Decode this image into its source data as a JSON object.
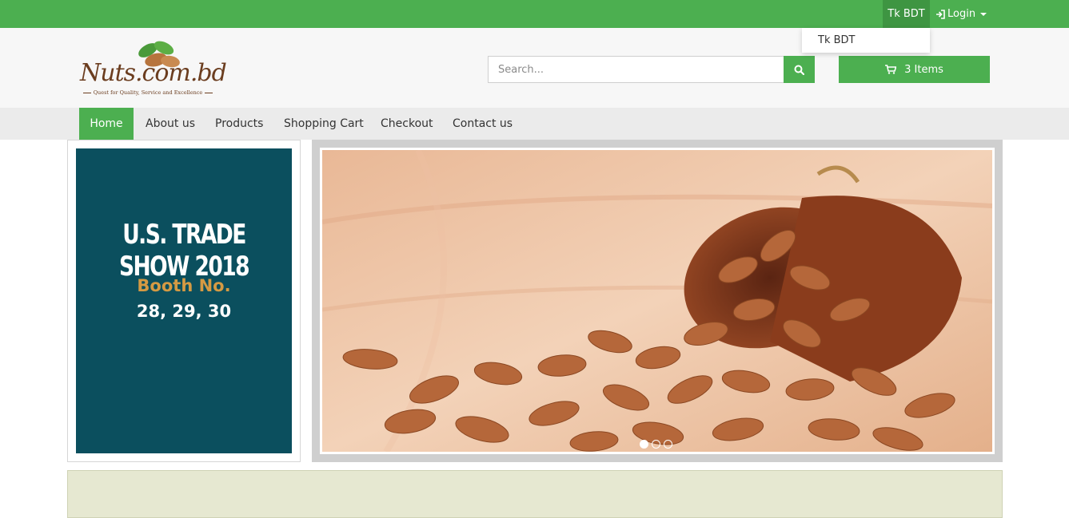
{
  "topbar": {
    "currency": "Tk BDT",
    "login": "Login"
  },
  "currency_dropdown": {
    "items": [
      "Tk BDT"
    ]
  },
  "header": {
    "logo_text": "Nuts.com.bd",
    "logo_tagline": "Quest for Quality, Service and Excellence",
    "search_placeholder": "Search...",
    "cart_label": "3 Items"
  },
  "nav": {
    "items": [
      "Home",
      "About us",
      "Products",
      "Shopping Cart",
      "Checkout",
      "Contact us"
    ]
  },
  "side_banner": {
    "title": "U.S. TRADE SHOW 2018",
    "booth_label": "Booth No.",
    "booth_numbers": "28, 29, 30"
  },
  "slider": {
    "slide_count": 3,
    "active_slide": 1
  },
  "colors": {
    "accent": "#4caf50",
    "accent_dark": "#3e9542",
    "banner_bg": "#0b4f5e",
    "booth_gold": "#d59a43",
    "logo_brown": "#6b3d1f"
  },
  "icons": {
    "login": "sign-in-icon",
    "search": "search-icon",
    "cart": "shopping-cart-icon"
  }
}
